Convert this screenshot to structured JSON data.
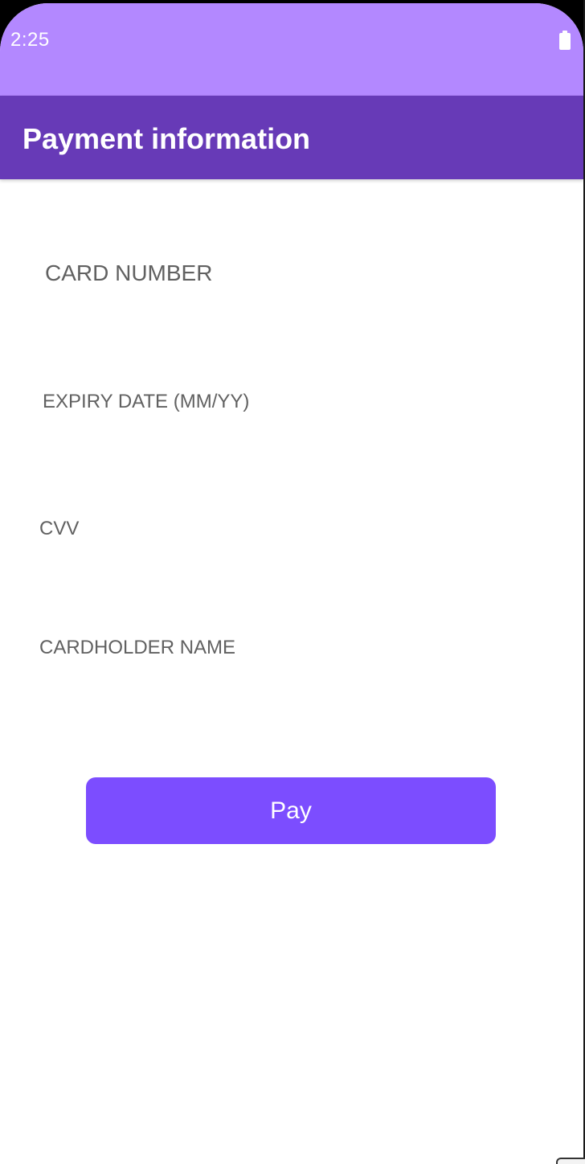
{
  "status_bar": {
    "time": "2:25",
    "battery_icon": "battery-full-icon"
  },
  "app_bar": {
    "title": "Payment information"
  },
  "form": {
    "card_number_label": "CARD NUMBER",
    "expiry_date_label": "EXPIRY DATE (MM/YY)",
    "cvv_label": "CVV",
    "cardholder_name_label": "CARDHOLDER NAME"
  },
  "actions": {
    "pay_label": "Pay"
  },
  "colors": {
    "status_bar": "#b388ff",
    "app_bar": "#673ab7",
    "accent_button": "#7c4dff",
    "field_text": "#616161"
  }
}
